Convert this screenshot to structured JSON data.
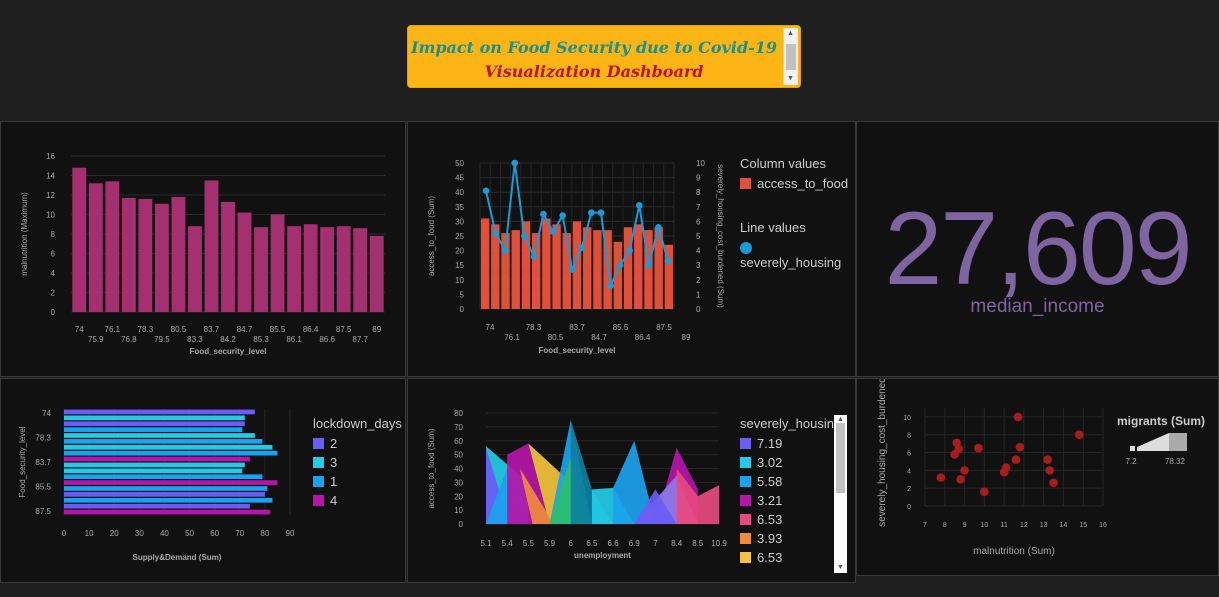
{
  "header": {
    "line1": "Impact on Food Security due to Covid-19",
    "line2": "Visualization Dashboard"
  },
  "colors": {
    "bar_purple": "#a4306f",
    "column_red": "#e04f3a",
    "line_blue": "#1a9bd7",
    "card_purple": "#7e64a0",
    "scatter_red": "#a71d1d"
  },
  "card": {
    "value": "27,609",
    "label": "median_income"
  },
  "chart_data": [
    {
      "type": "bar",
      "xlabel": "Food_security_level",
      "ylabel": "malnutrition (Maximum)",
      "ylim": [
        0,
        16
      ],
      "yticks": [
        "0",
        "2",
        "4",
        "6",
        "8",
        "10",
        "12",
        "14",
        "16"
      ],
      "categories": [
        "74",
        "75.9",
        "76.1",
        "76.8",
        "78.3",
        "79.5",
        "80.5",
        "83.3",
        "83.7",
        "84.2",
        "84.7",
        "85.3",
        "85.5",
        "86.1",
        "86.4",
        "86.6",
        "87.5",
        "87.7",
        "89"
      ],
      "values": [
        14.8,
        13.2,
        13.4,
        11.7,
        11.6,
        11.1,
        11.8,
        8.8,
        13.5,
        11.3,
        10.2,
        8.7,
        10.0,
        8.8,
        9.0,
        8.7,
        8.8,
        8.6,
        7.8
      ]
    },
    {
      "type": "bar+line",
      "xlabel": "Food_security_level",
      "ylabel": "access_to_food (Sum)",
      "y2label": "severely_housing_cost_burdened (Sum)",
      "ylim": [
        0,
        50
      ],
      "y2lim": [
        0,
        10
      ],
      "yticks": [
        "0",
        "5",
        "10",
        "15",
        "20",
        "25",
        "30",
        "35",
        "40",
        "45",
        "50"
      ],
      "y2ticks": [
        "0",
        "1",
        "2",
        "3",
        "4",
        "5",
        "6",
        "7",
        "8",
        "9",
        "10"
      ],
      "xticks_row1": [
        "74",
        "78.3",
        "83.7",
        "85.5",
        "87.5"
      ],
      "xticks_row2": [
        "76.1",
        "80.5",
        "84.7",
        "86.4",
        "89"
      ],
      "legend_col_title": "Column values",
      "legend_col_item": "access_to_food",
      "legend_line_title": "Line values",
      "legend_line_item": "severely_housing",
      "columns": [
        31,
        29,
        26,
        27,
        30,
        26,
        31,
        29,
        26,
        30,
        28,
        27,
        27,
        23,
        28,
        29,
        27,
        28,
        22
      ],
      "line": [
        8.1,
        5.2,
        4.0,
        10.0,
        5.0,
        3.6,
        6.5,
        5.3,
        6.4,
        2.7,
        4.2,
        6.6,
        6.6,
        1.6,
        3.0,
        4.0,
        7.1,
        3.0,
        5.6,
        3.3
      ]
    },
    {
      "type": "bar",
      "orientation": "horizontal",
      "xlabel": "Supply&Demand (Sum)",
      "ylabel": "Food_security_level",
      "xlim": [
        0,
        90
      ],
      "xticks": [
        "0",
        "10",
        "20",
        "30",
        "40",
        "50",
        "60",
        "70",
        "80",
        "90"
      ],
      "yticks": [
        "74",
        "78.3",
        "83.7",
        "85.5",
        "87.5"
      ],
      "legend_title": "lockdown_days",
      "legend": [
        {
          "name": "2",
          "color": "#6a5cf5"
        },
        {
          "name": "3",
          "color": "#23cbe7"
        },
        {
          "name": "1",
          "color": "#1aa2ee"
        },
        {
          "name": "4",
          "color": "#b515a8"
        }
      ],
      "values": [
        76,
        72,
        72,
        71,
        76,
        79,
        83,
        85,
        74,
        72,
        71,
        79,
        85,
        81,
        80,
        83,
        74,
        82
      ],
      "series_index": [
        0,
        1,
        0,
        2,
        1,
        2,
        1,
        2,
        3,
        1,
        1,
        2,
        3,
        2,
        0,
        2,
        0,
        3
      ]
    },
    {
      "type": "area",
      "xlabel": "unemployment",
      "ylabel": "access_to_food (Sum)",
      "ylim": [
        0,
        80
      ],
      "yticks": [
        "0",
        "10",
        "20",
        "30",
        "40",
        "50",
        "60",
        "70",
        "80"
      ],
      "xticks": [
        "5.1",
        "5.4",
        "5.5",
        "5.9",
        "6",
        "6.5",
        "6.6",
        "6.9",
        "7",
        "8.4",
        "8.5",
        "10.9"
      ],
      "legend_title": "severely_housing",
      "legend": [
        {
          "name": "7.19",
          "color": "#6a5cf5"
        },
        {
          "name": "3.02",
          "color": "#23cbe7"
        },
        {
          "name": "5.58",
          "color": "#1aa2ee"
        },
        {
          "name": "3.21",
          "color": "#b515a8"
        },
        {
          "name": "6.53",
          "color": "#e8497f"
        },
        {
          "name": "3.93",
          "color": "#f08b3c"
        },
        {
          "name": "6.53",
          "color": "#f5c33b"
        }
      ]
    },
    {
      "type": "scatter",
      "xlabel": "malnutrition (Sum)",
      "ylabel": "severely_housing_cost_burdened",
      "xlim": [
        7,
        16
      ],
      "ylim": [
        0,
        11
      ],
      "xticks": [
        "7",
        "8",
        "9",
        "10",
        "11",
        "12",
        "13",
        "14",
        "15",
        "16"
      ],
      "yticks": [
        "0",
        "2",
        "4",
        "6",
        "8",
        "10"
      ],
      "legend_title": "migrants (Sum)",
      "legend_min": "7.2",
      "legend_max": "78.32",
      "points": [
        [
          7.8,
          3.2
        ],
        [
          8.5,
          5.8
        ],
        [
          8.6,
          7.1
        ],
        [
          8.7,
          6.4
        ],
        [
          8.8,
          3.0
        ],
        [
          9.0,
          4.0
        ],
        [
          9.7,
          6.5
        ],
        [
          10.0,
          1.6
        ],
        [
          11.0,
          3.8
        ],
        [
          11.1,
          4.3
        ],
        [
          11.6,
          5.2
        ],
        [
          11.7,
          10.0
        ],
        [
          11.8,
          6.6
        ],
        [
          13.2,
          5.2
        ],
        [
          13.3,
          4.0
        ],
        [
          13.5,
          2.6
        ],
        [
          14.8,
          8.0
        ]
      ]
    }
  ]
}
